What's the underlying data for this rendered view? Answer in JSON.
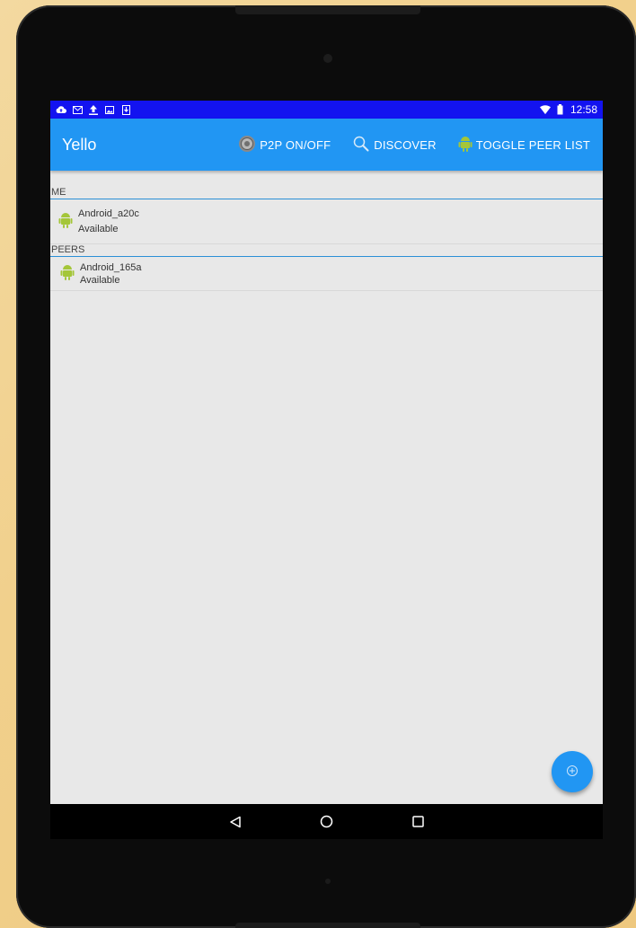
{
  "statusbar": {
    "icons": [
      "cloud-upload-icon",
      "mail-icon",
      "upload-icon",
      "image-icon",
      "download-icon"
    ],
    "time": "12:58",
    "color": "#1313f0"
  },
  "appbar": {
    "title": "Yello",
    "color": "#2196f3",
    "actions": [
      {
        "label": "P2P ON/OFF",
        "icon": "power-toggle-icon"
      },
      {
        "label": "DISCOVER",
        "icon": "search-icon"
      },
      {
        "label": "TOGGLE PEER LIST",
        "icon": "android-icon"
      }
    ]
  },
  "me": {
    "header": "ME",
    "device": {
      "name": "Android_a20c",
      "status": "Available"
    }
  },
  "peers": {
    "header": "PEERS",
    "devices": [
      {
        "name": "Android_165a",
        "status": "Available"
      }
    ]
  },
  "fab": {
    "icon": "add-circle-icon"
  },
  "navbar": {
    "buttons": [
      "back-icon",
      "home-icon",
      "recents-icon"
    ]
  }
}
